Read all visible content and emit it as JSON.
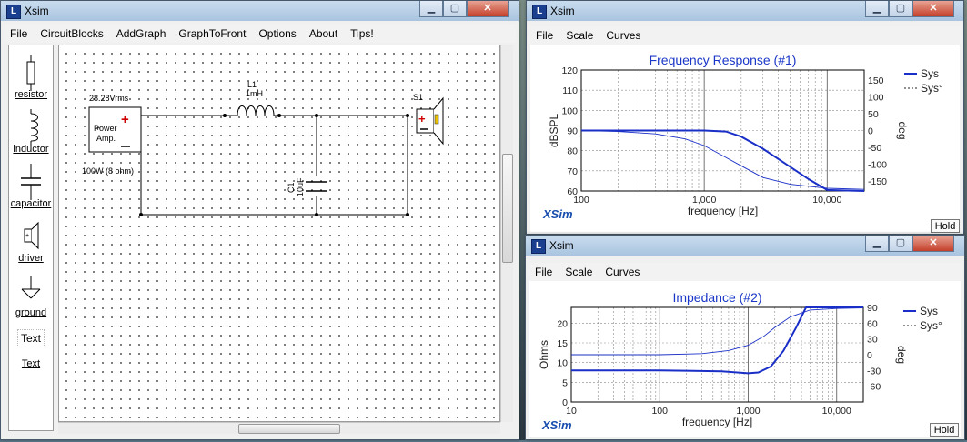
{
  "circuit_window": {
    "title": "Xsim",
    "menu": [
      "File",
      "CircuitBlocks",
      "AddGraph",
      "GraphToFront",
      "Options",
      "About",
      "Tips!"
    ],
    "palette": [
      {
        "label": "resistor",
        "icon": "resistor-icon"
      },
      {
        "label": "inductor",
        "icon": "inductor-icon"
      },
      {
        "label": "capacitor",
        "icon": "capacitor-icon"
      },
      {
        "label": "driver",
        "icon": "driver-icon"
      },
      {
        "label": "ground",
        "icon": "ground-icon"
      },
      {
        "label": "Text",
        "icon": "text-box-icon",
        "box": "Text"
      }
    ],
    "circuit": {
      "source_top": "28.28Vrms",
      "source_line1": "Power",
      "source_line2": "Amp.",
      "source_bottom": "100W (8 ohm)",
      "inductor_name": "L1",
      "inductor_value": "1mH",
      "capacitor_name": "C1",
      "capacitor_value": "10uF",
      "driver_name": "S1"
    }
  },
  "freq_window": {
    "title": "Xsim",
    "menu": [
      "File",
      "Scale",
      "Curves"
    ],
    "hold_label": "Hold",
    "brand": "XSim",
    "chart_data": {
      "type": "line",
      "title": "Frequency Response (#1)",
      "xlabel": "frequency [Hz]",
      "ylabel": "dBSPL",
      "y2label": "deg",
      "x_scale": "log",
      "xlim": [
        100,
        20000
      ],
      "ylim": [
        60,
        120
      ],
      "y2lim": [
        -180,
        180
      ],
      "x_ticks": [
        "100",
        "1,000",
        "10,000"
      ],
      "y_ticks": [
        "120",
        "110",
        "100",
        "90",
        "80",
        "70",
        "60"
      ],
      "y2_ticks": [
        "150",
        "100",
        "50",
        "0",
        "-50",
        "-100",
        "-150"
      ],
      "grid": true,
      "legend_position": "top-right",
      "series": [
        {
          "name": "Sys",
          "axis": "left",
          "style": "solid",
          "color": "#1a2fc8",
          "x": [
            100,
            300,
            1000,
            1500,
            2000,
            3000,
            5000,
            7000,
            10000,
            20000
          ],
          "y": [
            90,
            90,
            90,
            89.5,
            87,
            81,
            72,
            66,
            60.5,
            60
          ]
        },
        {
          "name": "Sys°",
          "axis": "right",
          "style": "thin",
          "color": "#1a2fc8",
          "x": [
            100,
            200,
            400,
            700,
            1000,
            1500,
            2000,
            3000,
            5000,
            10000,
            20000
          ],
          "y": [
            0,
            -3,
            -10,
            -25,
            -45,
            -80,
            -105,
            -140,
            -160,
            -172,
            -175
          ]
        }
      ]
    }
  },
  "imp_window": {
    "title": "Xsim",
    "menu": [
      "File",
      "Scale",
      "Curves"
    ],
    "hold_label": "Hold",
    "brand": "XSim",
    "chart_data": {
      "type": "line",
      "title": "Impedance (#2)",
      "xlabel": "frequency [Hz]",
      "ylabel": "Ohms",
      "y2label": "deg",
      "x_scale": "log",
      "xlim": [
        10,
        20000
      ],
      "ylim": [
        0,
        24
      ],
      "y2lim": [
        -90,
        90
      ],
      "x_ticks": [
        "10",
        "100",
        "1,000",
        "10,000"
      ],
      "y_ticks": [
        "20",
        "15",
        "10",
        "5",
        "0"
      ],
      "y2_ticks": [
        "90",
        "60",
        "30",
        "0",
        "-30",
        "-60"
      ],
      "grid": true,
      "legend_position": "top-right",
      "series": [
        {
          "name": "Sys",
          "axis": "left",
          "style": "solid",
          "color": "#1a2fc8",
          "x": [
            10,
            100,
            500,
            1000,
            1300,
            1800,
            2500,
            3500,
            4500,
            6000,
            20000
          ],
          "y": [
            8,
            8,
            7.8,
            7.3,
            7.5,
            9,
            13,
            19,
            24,
            24,
            24
          ]
        },
        {
          "name": "Sys°",
          "axis": "right",
          "style": "thin",
          "color": "#1a2fc8",
          "x": [
            10,
            100,
            300,
            600,
            1000,
            1500,
            2000,
            3000,
            5000,
            10000,
            20000
          ],
          "y": [
            0,
            0,
            2,
            8,
            18,
            35,
            52,
            72,
            85,
            88,
            89
          ]
        }
      ]
    }
  }
}
